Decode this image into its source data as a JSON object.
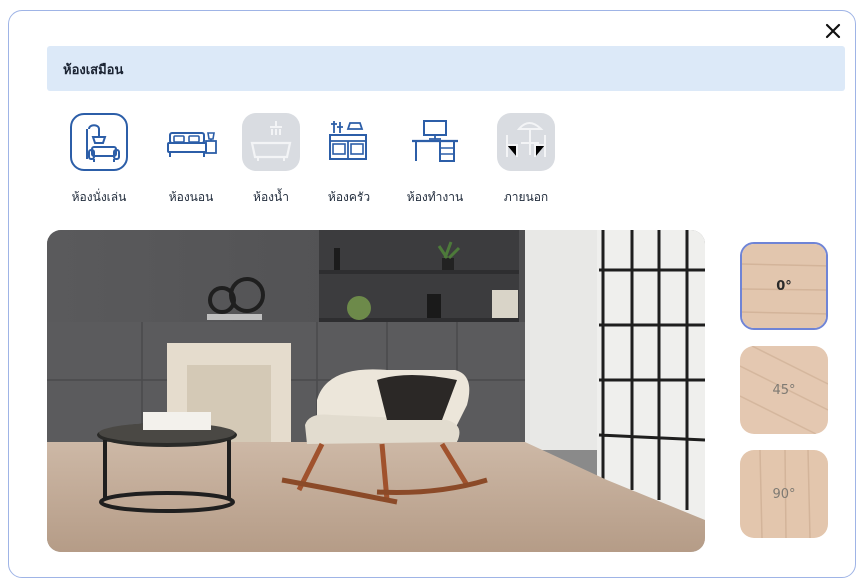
{
  "modal": {
    "title": "ห้องเสมือน",
    "close_icon": "close-icon"
  },
  "rooms": [
    {
      "label": "ห้องนั่งเล่น",
      "icon": "sofa-lamp-icon",
      "state": "active"
    },
    {
      "label": "ห้องนอน",
      "icon": "bed-icon",
      "state": "normal"
    },
    {
      "label": "ห้องน้ำ",
      "icon": "bathtub-shower-icon",
      "state": "disabled"
    },
    {
      "label": "ห้องครัว",
      "icon": "kitchen-stove-icon",
      "state": "normal"
    },
    {
      "label": "ห้องทำงาน",
      "icon": "desk-computer-icon",
      "state": "normal"
    },
    {
      "label": "ภายนอก",
      "icon": "patio-umbrella-icon",
      "state": "disabled"
    }
  ],
  "preview": {
    "scene": "living-room-preview"
  },
  "angles": [
    {
      "label": "0°",
      "selected": true
    },
    {
      "label": "45°",
      "selected": false
    },
    {
      "label": "90°",
      "selected": false
    }
  ],
  "colors": {
    "accent": "#2c5ea8",
    "title_bar": "#dce9f8",
    "border": "#9fb4e6"
  }
}
